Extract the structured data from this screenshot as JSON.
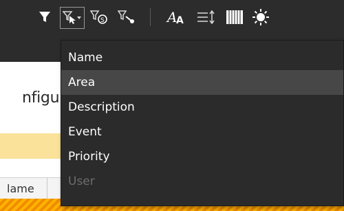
{
  "toolbar": {
    "icons": [
      {
        "name": "filter-icon"
      },
      {
        "name": "filter-select-dropdown-icon"
      },
      {
        "name": "filter-settings-icon"
      },
      {
        "name": "filter-wrench-icon"
      },
      {
        "name": "font-size-icon"
      },
      {
        "name": "line-spacing-icon"
      },
      {
        "name": "columns-icon"
      },
      {
        "name": "brightness-icon"
      }
    ]
  },
  "menu": {
    "items": [
      {
        "label": "Name",
        "state": "normal"
      },
      {
        "label": "Area",
        "state": "hover"
      },
      {
        "label": "Description",
        "state": "normal"
      },
      {
        "label": "Event",
        "state": "normal"
      },
      {
        "label": "Priority",
        "state": "normal"
      },
      {
        "label": "User",
        "state": "disabled"
      }
    ]
  },
  "page": {
    "title_fragment": "nfigu",
    "column_header_fragment": "lame"
  },
  "colors": {
    "toolbar_bg": "#2c2c2c",
    "menu_bg": "#2b2b2b",
    "menu_hover": "#474747",
    "strip_yellow": "#fbe29b",
    "row_orange": "#f5a300"
  }
}
